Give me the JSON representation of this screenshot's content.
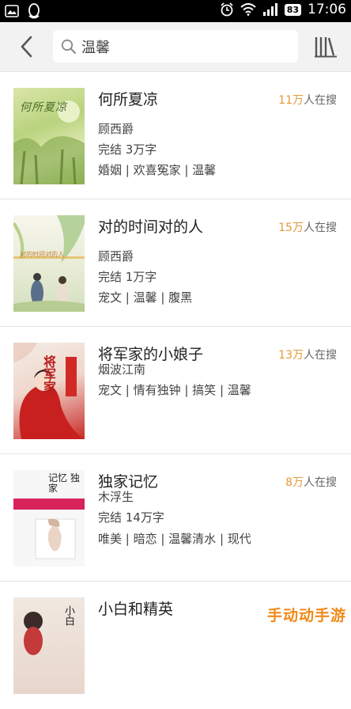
{
  "status_bar": {
    "time": "17:06",
    "battery": "83"
  },
  "search": {
    "query": "温馨"
  },
  "books": [
    {
      "title": "何所夏凉",
      "count": "11万",
      "count_suffix": "人在搜",
      "author": "顾西爵",
      "status": "完结 3万字",
      "tags": "婚姻 | 欢喜冤家 | 温馨",
      "cover_text": "何所夏凉"
    },
    {
      "title": "对的时间对的人",
      "count": "15万",
      "count_suffix": "人在搜",
      "author": "顾西爵",
      "status": "完结 1万字",
      "tags": "宠文 | 温馨 | 腹黑",
      "cover_text": "对的时间对的人"
    },
    {
      "title": "将军家的小娘子",
      "count": "13万",
      "count_suffix": "人在搜",
      "author": "烟波江南",
      "status": "",
      "tags": "宠文 | 情有独钟 | 搞笑 | 温馨",
      "cover_text": "将军家"
    },
    {
      "title": "独家记忆",
      "count": "8万",
      "count_suffix": "人在搜",
      "author": "木浮生",
      "status": "完结 14万字",
      "tags": "唯美 | 暗恋 | 温馨清水 | 现代",
      "cover_text": "记忆 独家"
    },
    {
      "title": "小白和精英",
      "count": "",
      "count_suffix": "",
      "author": "",
      "status": "",
      "tags": "",
      "cover_text": "小白"
    }
  ],
  "watermark": "手动动手游",
  "colors": {
    "accent": "#e39a36",
    "header_bg": "#f2f2f2",
    "status_bg": "#000000"
  }
}
